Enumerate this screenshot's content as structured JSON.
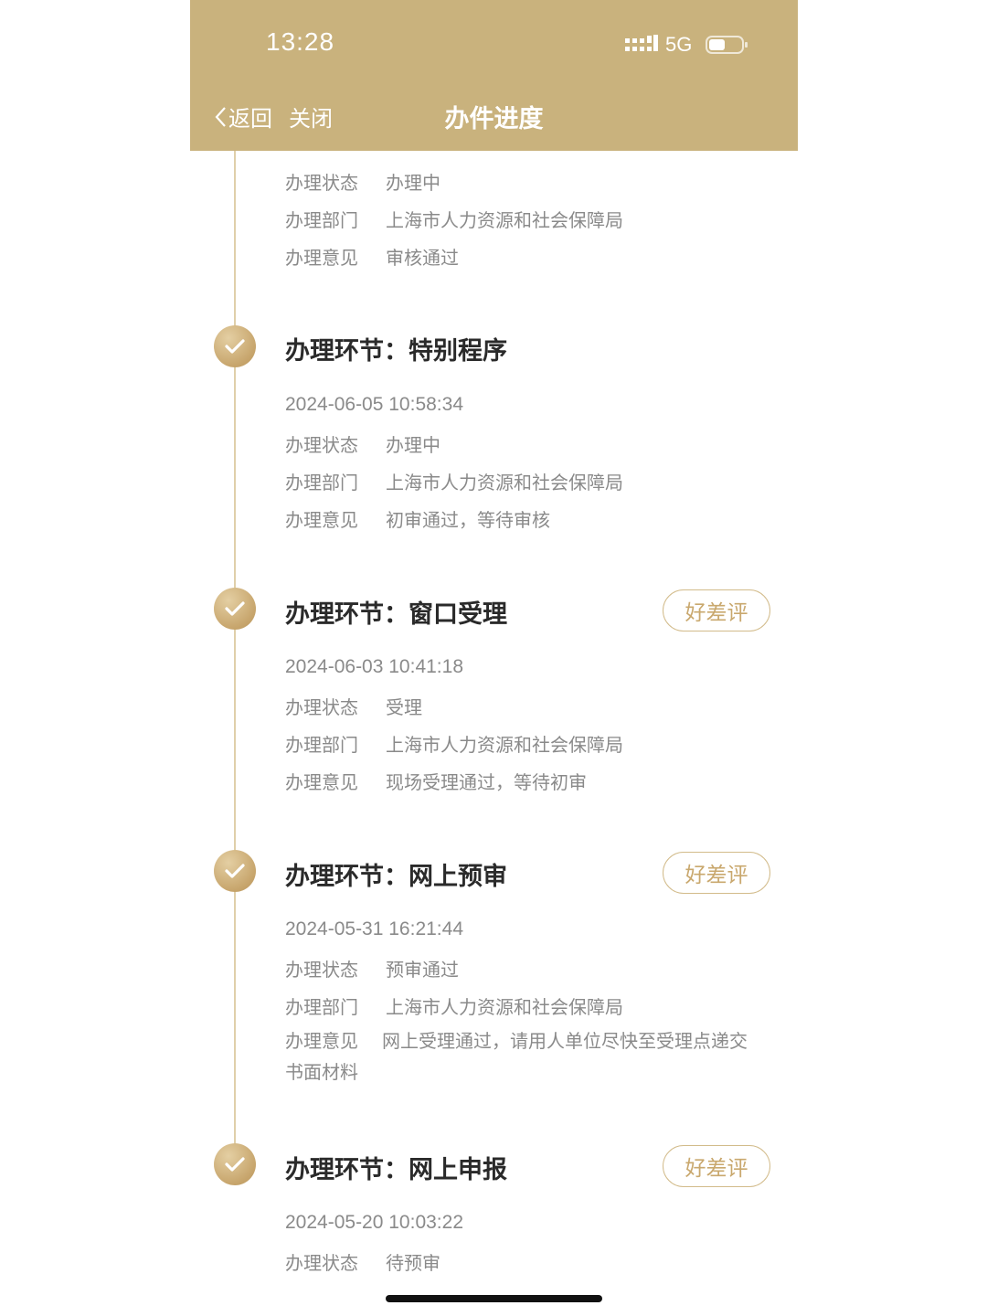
{
  "status_bar": {
    "time": "13:28",
    "network": "5G"
  },
  "nav": {
    "back_label": "返回",
    "close_label": "关闭",
    "title": "办件进度"
  },
  "top_partial": {
    "rows": [
      {
        "label": "办理状态",
        "value": "办理中"
      },
      {
        "label": "办理部门",
        "value": "上海市人力资源和社会保障局"
      },
      {
        "label": "办理意见",
        "value": "审核通过"
      }
    ]
  },
  "steps": [
    {
      "title": "办理环节：特别程序",
      "timestamp": "2024-06-05 10:58:34",
      "status_label": "办理状态",
      "status_value": "办理中",
      "dept_label": "办理部门",
      "dept_value": "上海市人力资源和社会保障局",
      "opinion_label": "办理意见",
      "opinion_value": "初审通过，等待审核"
    },
    {
      "title": "办理环节：窗口受理",
      "rate_label": "好差评",
      "timestamp": "2024-06-03 10:41:18",
      "status_label": "办理状态",
      "status_value": "受理",
      "dept_label": "办理部门",
      "dept_value": "上海市人力资源和社会保障局",
      "opinion_label": "办理意见",
      "opinion_value": "现场受理通过，等待初审"
    },
    {
      "title": "办理环节：网上预审",
      "rate_label": "好差评",
      "timestamp": "2024-05-31 16:21:44",
      "status_label": "办理状态",
      "status_value": "预审通过",
      "dept_label": "办理部门",
      "dept_value": "上海市人力资源和社会保障局",
      "opinion_label": "办理意见",
      "opinion_value": "网上受理通过，请用人单位尽快至受理点递交书面材料"
    },
    {
      "title": "办理环节：网上申报",
      "rate_label": "好差评",
      "timestamp": "2024-05-20 10:03:22",
      "status_label": "办理状态",
      "status_value": "待预审"
    }
  ],
  "colors": {
    "header_bg": "#c9b27d",
    "accent_gold": "#c9a86e",
    "timeline": "#dfcfaa",
    "secondary_text": "#8a8a8a",
    "title_text": "#2a2a2a"
  },
  "icons": [
    "chevron-left-icon",
    "signal-icon",
    "battery-icon",
    "checkmark-icon"
  ]
}
